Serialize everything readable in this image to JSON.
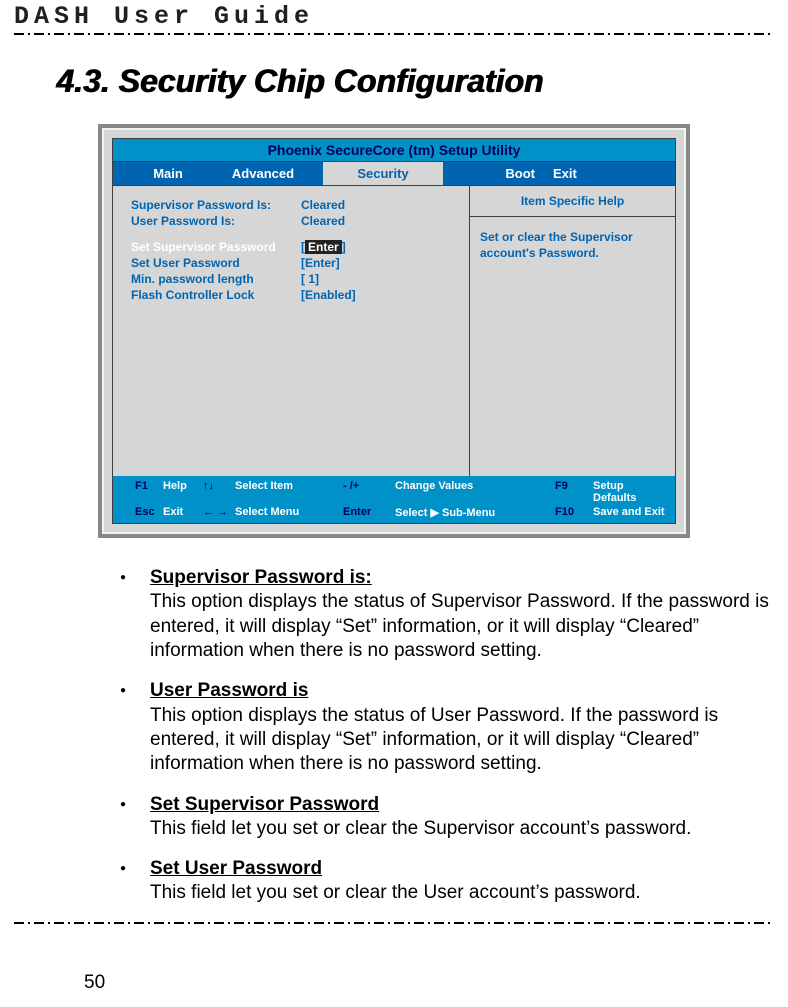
{
  "doc": {
    "header": "DASH User Guide",
    "section_title": "4.3. Security Chip Configuration",
    "page_number": "50"
  },
  "bios": {
    "title": "Phoenix SecureCore (tm) Setup Utility",
    "tabs": {
      "main": "Main",
      "advanced": "Advanced",
      "security": "Security",
      "boot": "Boot",
      "exit": "Exit"
    },
    "left_rows": [
      {
        "label": "Supervisor Password Is:",
        "value": "Cleared",
        "white": false,
        "boxed": false
      },
      {
        "label": "User Password Is:",
        "value": "Cleared",
        "white": false,
        "boxed": false
      },
      {
        "spacer": true
      },
      {
        "label": "Set Supervisor Password",
        "value_prefix": "[",
        "value": "Enter",
        "value_suffix": "]",
        "white": true,
        "boxed": true
      },
      {
        "label": "Set User Password",
        "value": "[Enter]",
        "white": false,
        "boxed": false
      },
      {
        "label": "Min. password length",
        "value": "[        1]",
        "white": false,
        "boxed": false
      },
      {
        "label": "Flash Controller Lock",
        "value": "[Enabled]",
        "white": false,
        "boxed": false
      }
    ],
    "right": {
      "head": "Item Specific Help",
      "body": "Set or clear the Supervisor account's Password."
    },
    "footer": {
      "r1": {
        "k1": "F1",
        "v1": "Help",
        "a1": "↑↓",
        "v2": "Select Item",
        "k2": "- /+",
        "v3": "Change Values",
        "k3": "F9",
        "v4": "Setup Defaults"
      },
      "r2": {
        "k1": "Esc",
        "v1": "Exit",
        "a1": "← →",
        "v2": "Select Menu",
        "k2": "Enter",
        "v3": "Select  ▶ Sub-Menu",
        "k3": "F10",
        "v4": "Save and Exit"
      }
    }
  },
  "bullets": [
    {
      "heading": "Supervisor Password is:  ",
      "body": "This option displays the status of Supervisor Password. If the password is entered, it will display “Set” information, or it will display “Cleared” information when there is no password setting."
    },
    {
      "heading": "User Password is",
      "body": "This option displays the status of User Password. If the password is entered, it will display “Set” information, or it will display “Cleared” information when there is no password setting."
    },
    {
      "heading": "Set Supervisor Password",
      "body": "This field let you set or clear the Supervisor account’s password."
    },
    {
      "heading": "Set User Password",
      "body": "This field let you set or clear the User account’s password."
    }
  ]
}
